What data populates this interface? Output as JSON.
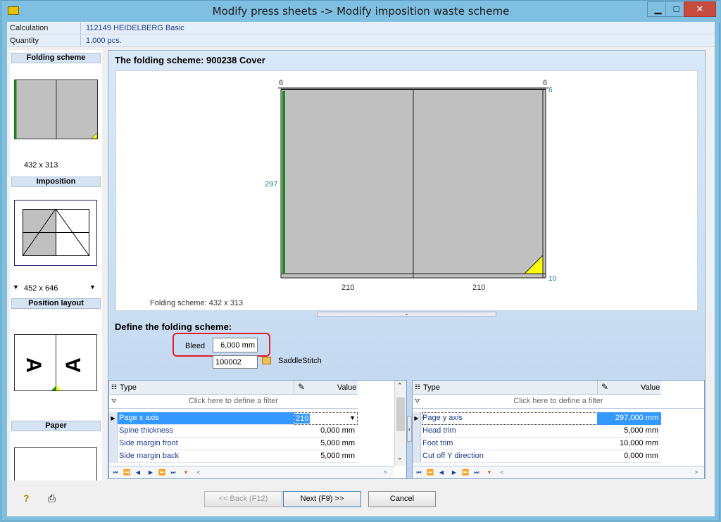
{
  "window": {
    "title": "Modify press sheets -> Modify imposition waste scheme",
    "minimize": "▁",
    "maximize": "□",
    "close": "✕"
  },
  "info": [
    {
      "label": "Calculation",
      "value": "112149 HEIDELBERG Basic"
    },
    {
      "label": "Quantity",
      "value": "1.000 pcs."
    }
  ],
  "left": {
    "folding_scheme": {
      "title": "Folding scheme",
      "size": "432 x 313"
    },
    "imposition": {
      "title": "Imposition",
      "size": "452 x 646"
    },
    "position_layout": {
      "title": "Position layout"
    },
    "paper": {
      "title": "Paper"
    }
  },
  "main": {
    "title": "The folding scheme: 900238 Cover",
    "dims": {
      "left_top": "6",
      "right_top": "6",
      "right_top_blue": "6",
      "height": "297",
      "width_left": "210",
      "width_right": "210",
      "bottom_right": "10"
    },
    "caption": "Folding scheme: 432 x 313",
    "define_title": "Define the folding scheme:",
    "bleed_label": "Bleed",
    "bleed_value": "6,000 mm",
    "scheme_code": "100002",
    "scheme_name": "SaddleStitch"
  },
  "grid_left": {
    "col_type": "Type",
    "col_value": "Value",
    "filter": "Click here to define a filter",
    "rows": [
      {
        "type": "Page x axis",
        "value": "210"
      },
      {
        "type": "Spine thickness",
        "value": "0,000 mm"
      },
      {
        "type": "Side margin front",
        "value": "5,000 mm"
      },
      {
        "type": "Side margin back",
        "value": "5,000 mm"
      }
    ]
  },
  "grid_right": {
    "col_type": "Type",
    "col_value": "Value",
    "filter": "Click here to define a filter",
    "rows": [
      {
        "type": "Page y axis",
        "value": "297,000 mm"
      },
      {
        "type": "Head trim",
        "value": "5,000 mm"
      },
      {
        "type": "Foot trim",
        "value": "10,000 mm"
      },
      {
        "type": "Cut off Y direction",
        "value": "0,000 mm"
      }
    ]
  },
  "buttons": {
    "back": "<< Back (F12)",
    "next": "Next (F9) >>",
    "cancel": "Cancel"
  },
  "colors": {
    "accent": "#3399ff",
    "spine": "#1e8a1e",
    "marker": "#ffff00",
    "highlight": "#e21e2a"
  }
}
